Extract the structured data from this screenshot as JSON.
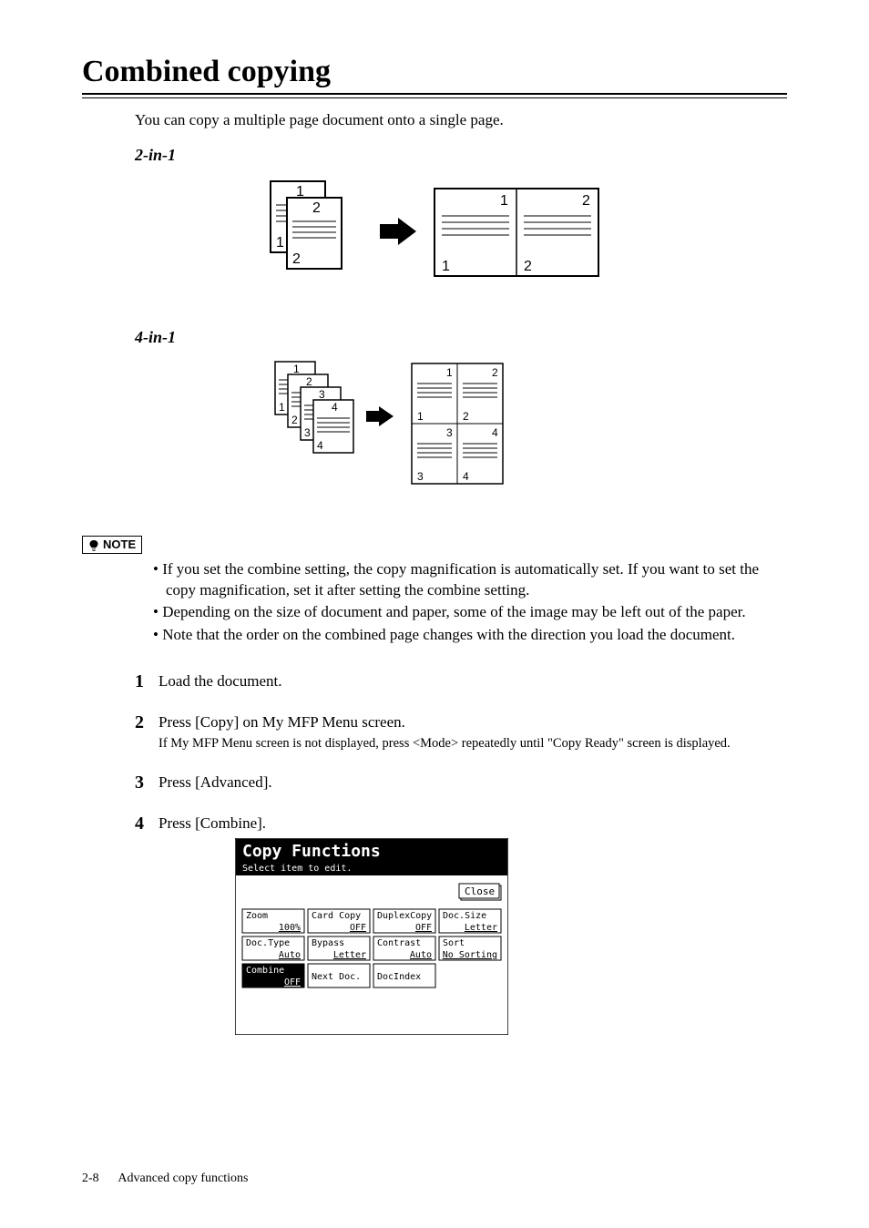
{
  "title": "Combined copying",
  "intro": "You can copy a multiple page document onto a single page.",
  "sections": {
    "two_in_one": "2-in-1",
    "four_in_one": "4-in-1"
  },
  "note_label": "NOTE",
  "notes": [
    "If you set the combine setting, the copy magnification is automatically set.  If you want to set the copy magnification, set it after setting the combine setting.",
    "Depending on the size of document and paper, some of the image may be left out of the paper.",
    "Note that the order on the combined page changes with the direction you load the document."
  ],
  "steps": [
    {
      "num": "1",
      "text": "Load the document."
    },
    {
      "num": "2",
      "text": "Press [Copy] on My MFP Menu screen.",
      "sub": "If My MFP Menu screen is not displayed, press <Mode> repeatedly until \"Copy Ready\" screen is displayed."
    },
    {
      "num": "3",
      "text": "Press [Advanced]."
    },
    {
      "num": "4",
      "text": "Press [Combine]."
    }
  ],
  "lcd": {
    "title": "Copy Functions",
    "subtitle": "Select item to edit.",
    "close": "Close",
    "buttons": [
      {
        "label": "Zoom",
        "value": "100%"
      },
      {
        "label": "Card Copy",
        "value": "OFF"
      },
      {
        "label": "DuplexCopy",
        "value": "OFF"
      },
      {
        "label": "Doc.Size",
        "value": "Letter"
      },
      {
        "label": "Doc.Type",
        "value": "Auto"
      },
      {
        "label": "Bypass",
        "value": "Letter"
      },
      {
        "label": "Contrast",
        "value": "Auto"
      },
      {
        "label": "Sort",
        "value": "No Sorting"
      },
      {
        "label": "Combine",
        "value": "OFF",
        "selected": true
      },
      {
        "label": "Next Doc.",
        "value": ""
      },
      {
        "label": "DocIndex",
        "value": ""
      }
    ]
  },
  "footer": {
    "page": "2-8",
    "section": "Advanced copy functions"
  }
}
